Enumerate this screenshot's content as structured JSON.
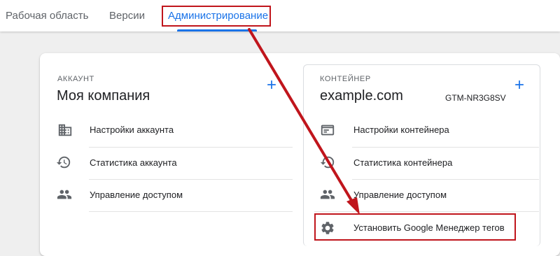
{
  "tabs": [
    {
      "label": "Рабочая область"
    },
    {
      "label": "Версии"
    },
    {
      "label": "Администрирование"
    }
  ],
  "account": {
    "section_label": "АККАУНТ",
    "title": "Моя компания",
    "add_icon": "plus-icon",
    "items": [
      {
        "label": "Настройки аккаунта",
        "icon": "building-icon"
      },
      {
        "label": "Статистика аккаунта",
        "icon": "history-icon"
      },
      {
        "label": "Управление доступом",
        "icon": "people-icon"
      }
    ]
  },
  "container": {
    "section_label": "КОНТЕЙНЕР",
    "title": "example.com",
    "container_id": "GTM-NR3G8SV",
    "add_icon": "plus-icon",
    "items": [
      {
        "label": "Настройки контейнера",
        "icon": "window-icon"
      },
      {
        "label": "Статистика контейнера",
        "icon": "history-icon"
      },
      {
        "label": "Управление доступом",
        "icon": "people-icon"
      },
      {
        "label": "Установить Google Менеджер тегов",
        "icon": "gear-icon"
      }
    ]
  },
  "colors": {
    "accent": "#1a73e8",
    "highlight": "#c0151c",
    "icon": "#5f6368"
  }
}
